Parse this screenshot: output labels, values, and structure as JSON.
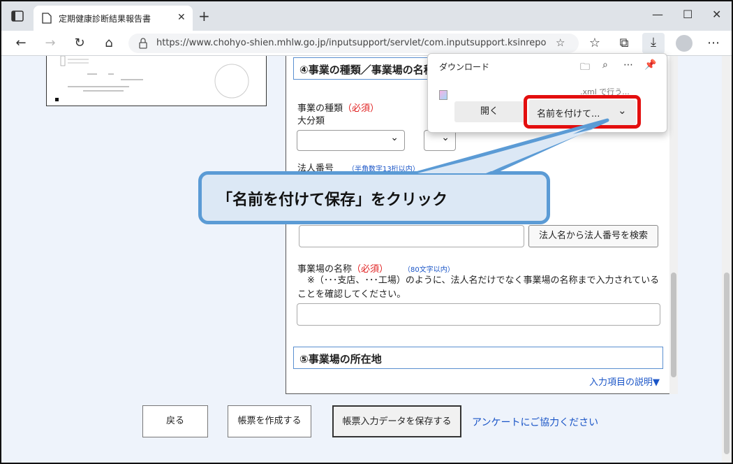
{
  "browser": {
    "tab_title": "定期健康診断結果報告書",
    "url": "https://www.chohyo-shien.mhlw.go.jp/inputsupport/servlet/com.inputsupport.ksinrepo"
  },
  "form": {
    "section4_title": "④事業の種類／事業場の名称",
    "business_type_label": "事業の種類",
    "required": "（必須）",
    "major_category": "大分類",
    "corp_number_label": "法人番号",
    "corp_number_hint": "（半角数字13桁以内）",
    "search_corp_button": "法人名から法人番号を検索",
    "workplace_name_label": "事業場の名称",
    "workplace_name_hint": "（80文字以内）",
    "workplace_note": "※（･･･支店、･･･工場）のように、法人名だけでなく事業場の名称まで入力されていることを確認してください。",
    "section5_title": "⑤事業場の所在地",
    "input_help_link": "入力項目の説明▼"
  },
  "bottom": {
    "back_button": "戻る",
    "create_button": "帳票を作成する",
    "save_data_button": "帳票入力データを保存する",
    "survey_link": "アンケートにご協力ください"
  },
  "download_panel": {
    "title": "ダウンロード",
    "file_suffix": ".xml で行う...",
    "open_button": "開く",
    "save_as_button": "名前を付けて..."
  },
  "callout": {
    "text": "「名前を付けて保存」をクリック"
  },
  "colors": {
    "highlight": "#e30e0e",
    "callout_border": "#5b9bd5",
    "callout_fill": "#dce8f5",
    "link": "#1a55c7"
  }
}
